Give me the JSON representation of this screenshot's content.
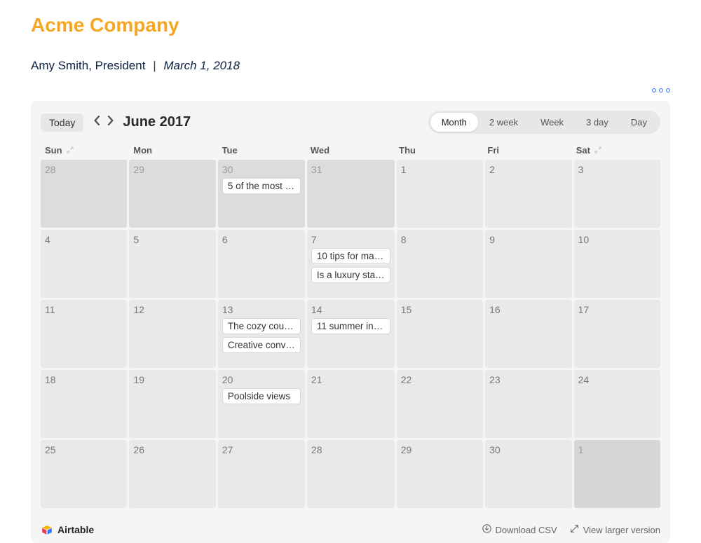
{
  "header": {
    "company": "Acme Company",
    "author": "Amy Smith, President",
    "divider": "|",
    "date": "March 1, 2018"
  },
  "toolbar": {
    "today": "Today",
    "month_label": "June 2017",
    "views": [
      "Month",
      "2 week",
      "Week",
      "3 day",
      "Day"
    ],
    "active_view_index": 0
  },
  "dow": [
    "Sun",
    "Mon",
    "Tue",
    "Wed",
    "Thu",
    "Fri",
    "Sat"
  ],
  "cells": [
    {
      "n": "28",
      "outside": true
    },
    {
      "n": "29",
      "outside": true
    },
    {
      "n": "30",
      "outside": true,
      "events": [
        "5 of the most …"
      ]
    },
    {
      "n": "31",
      "outside": true
    },
    {
      "n": "1"
    },
    {
      "n": "2"
    },
    {
      "n": "3"
    },
    {
      "n": "4"
    },
    {
      "n": "5"
    },
    {
      "n": "6"
    },
    {
      "n": "7",
      "events": [
        "10 tips for ma…",
        "Is a luxury sta…"
      ]
    },
    {
      "n": "8"
    },
    {
      "n": "9"
    },
    {
      "n": "10"
    },
    {
      "n": "11"
    },
    {
      "n": "12"
    },
    {
      "n": "13",
      "events": [
        "The cozy cou…",
        "Creative conv…"
      ]
    },
    {
      "n": "14",
      "events": [
        "11 summer in…"
      ]
    },
    {
      "n": "15"
    },
    {
      "n": "16"
    },
    {
      "n": "17"
    },
    {
      "n": "18"
    },
    {
      "n": "19"
    },
    {
      "n": "20",
      "events": [
        "Poolside views"
      ]
    },
    {
      "n": "21"
    },
    {
      "n": "22"
    },
    {
      "n": "23"
    },
    {
      "n": "24"
    },
    {
      "n": "25"
    },
    {
      "n": "26"
    },
    {
      "n": "27"
    },
    {
      "n": "28"
    },
    {
      "n": "29"
    },
    {
      "n": "30"
    },
    {
      "n": "1",
      "outside2": true
    }
  ],
  "footer": {
    "brand": "Airtable",
    "download": "Download CSV",
    "larger": "View larger version"
  }
}
